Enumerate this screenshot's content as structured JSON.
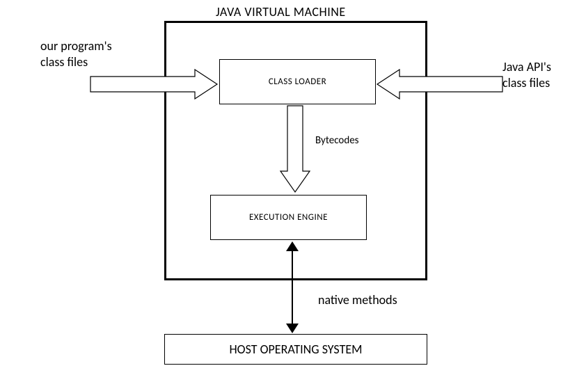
{
  "title": "JAVA VIRTUAL MACHINE",
  "boxes": {
    "class_loader": "CLASS LOADER",
    "execution_engine": "EXECUTION ENGINE",
    "host_os": "HOST OPERATING SYSTEM"
  },
  "labels": {
    "left_input_line1": "our program's",
    "left_input_line2": "class files",
    "right_input_line1": "Java API's",
    "right_input_line2": "class files",
    "bytecodes": "Bytecodes",
    "native_methods": "native methods"
  }
}
